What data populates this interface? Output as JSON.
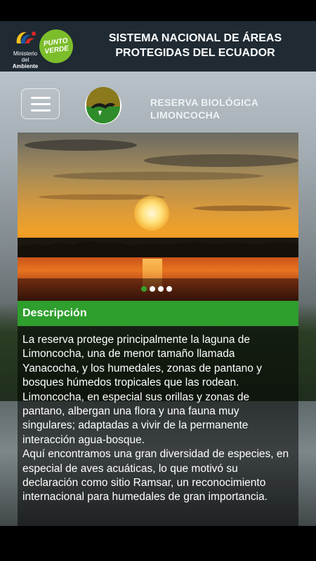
{
  "header": {
    "ministerio_line1": "Ministerio",
    "ministerio_line2": "del",
    "ministerio_line3": "Ambiente",
    "punto_verde_line1": "PUNTO",
    "punto_verde_line2": "VERDE",
    "title": "SISTEMA NACIONAL DE ÁREAS PROTEGIDAS DEL ECUADOR"
  },
  "toolbar": {
    "menu_icon": "hamburger-menu-icon",
    "reserve_name": "RESERVA BIOLÓGICA LIMONCOCHA"
  },
  "slider": {
    "image": "sunset-over-lagoon",
    "total_slides": 4,
    "active_slide": 1
  },
  "description": {
    "title": "Descripción",
    "body": "La reserva protege principalmente la laguna de Limoncocha, una de menor tamaño llamada Yanacocha, y los humedales, zonas de pantano y bosques húmedos tropicales que las rodean. Limoncocha, en especial sus orillas y zonas de pantano, albergan una flora y una fauna muy singulares; adaptadas a vivir de la permanente interacción agua-bosque.\nAquí encontramos una gran diversidad de especies, en especial de aves acuáticas, lo que motivó su declaración como sitio Ramsar, un reconocimiento internacional para humedales de gran importancia."
  },
  "colors": {
    "header_bg": "#1f2a33",
    "accent_green": "#2e9e2d",
    "punto_verde_green": "#7cbd2b"
  }
}
